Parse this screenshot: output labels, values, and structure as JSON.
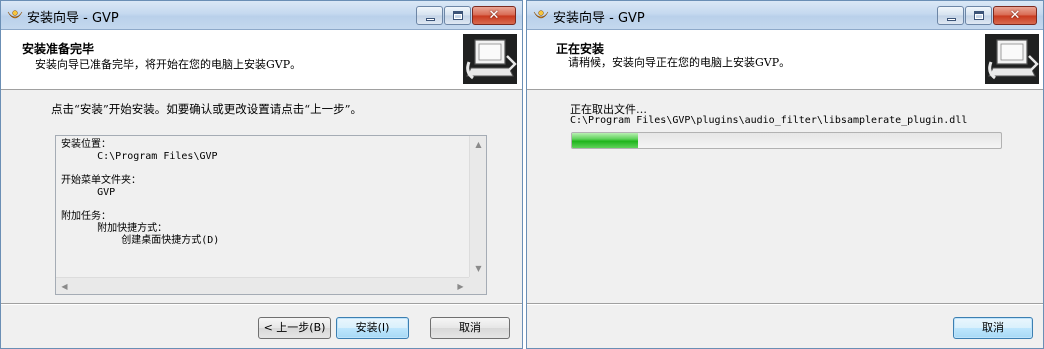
{
  "left_window": {
    "title": "安装向导 - GVP",
    "header_title": "安装准备完毕",
    "header_subtitle": "安装向导已准备完毕，将开始在您的电脑上安装GVP。",
    "instruction": "点击“安装”开始安装。如要确认或更改设置请点击“上一步”。",
    "memo_lines": [
      "安装位置：",
      "      C:\\Program Files\\GVP",
      "",
      "开始菜单文件夹：",
      "      GVP",
      "",
      "附加任务：",
      "      附加快捷方式：",
      "          创建桌面快捷方式(D)"
    ],
    "buttons": {
      "back": "< 上一步(B)",
      "install": "安装(I)",
      "cancel": "取消"
    }
  },
  "right_window": {
    "title": "安装向导 - GVP",
    "header_title": "正在安装",
    "header_subtitle": "请稍候，安装向导正在您的电脑上安装GVP。",
    "status_label": "正在取出文件…",
    "current_file": "C:\\Program Files\\GVP\\plugins\\audio_filter\\libsamplerate_plugin.dll",
    "progress_fraction": 0.155,
    "buttons": {
      "cancel": "取消"
    }
  },
  "icons": {
    "app": "gvp-app-icon",
    "wizard": "computer-install-icon",
    "minimize": "minimize-icon",
    "maximize": "maximize-icon",
    "close": "close-icon"
  },
  "colors": {
    "progress_green": "#1fb51c",
    "close_red": "#c8381d",
    "titlebar_blue": "#c5d9ef"
  }
}
